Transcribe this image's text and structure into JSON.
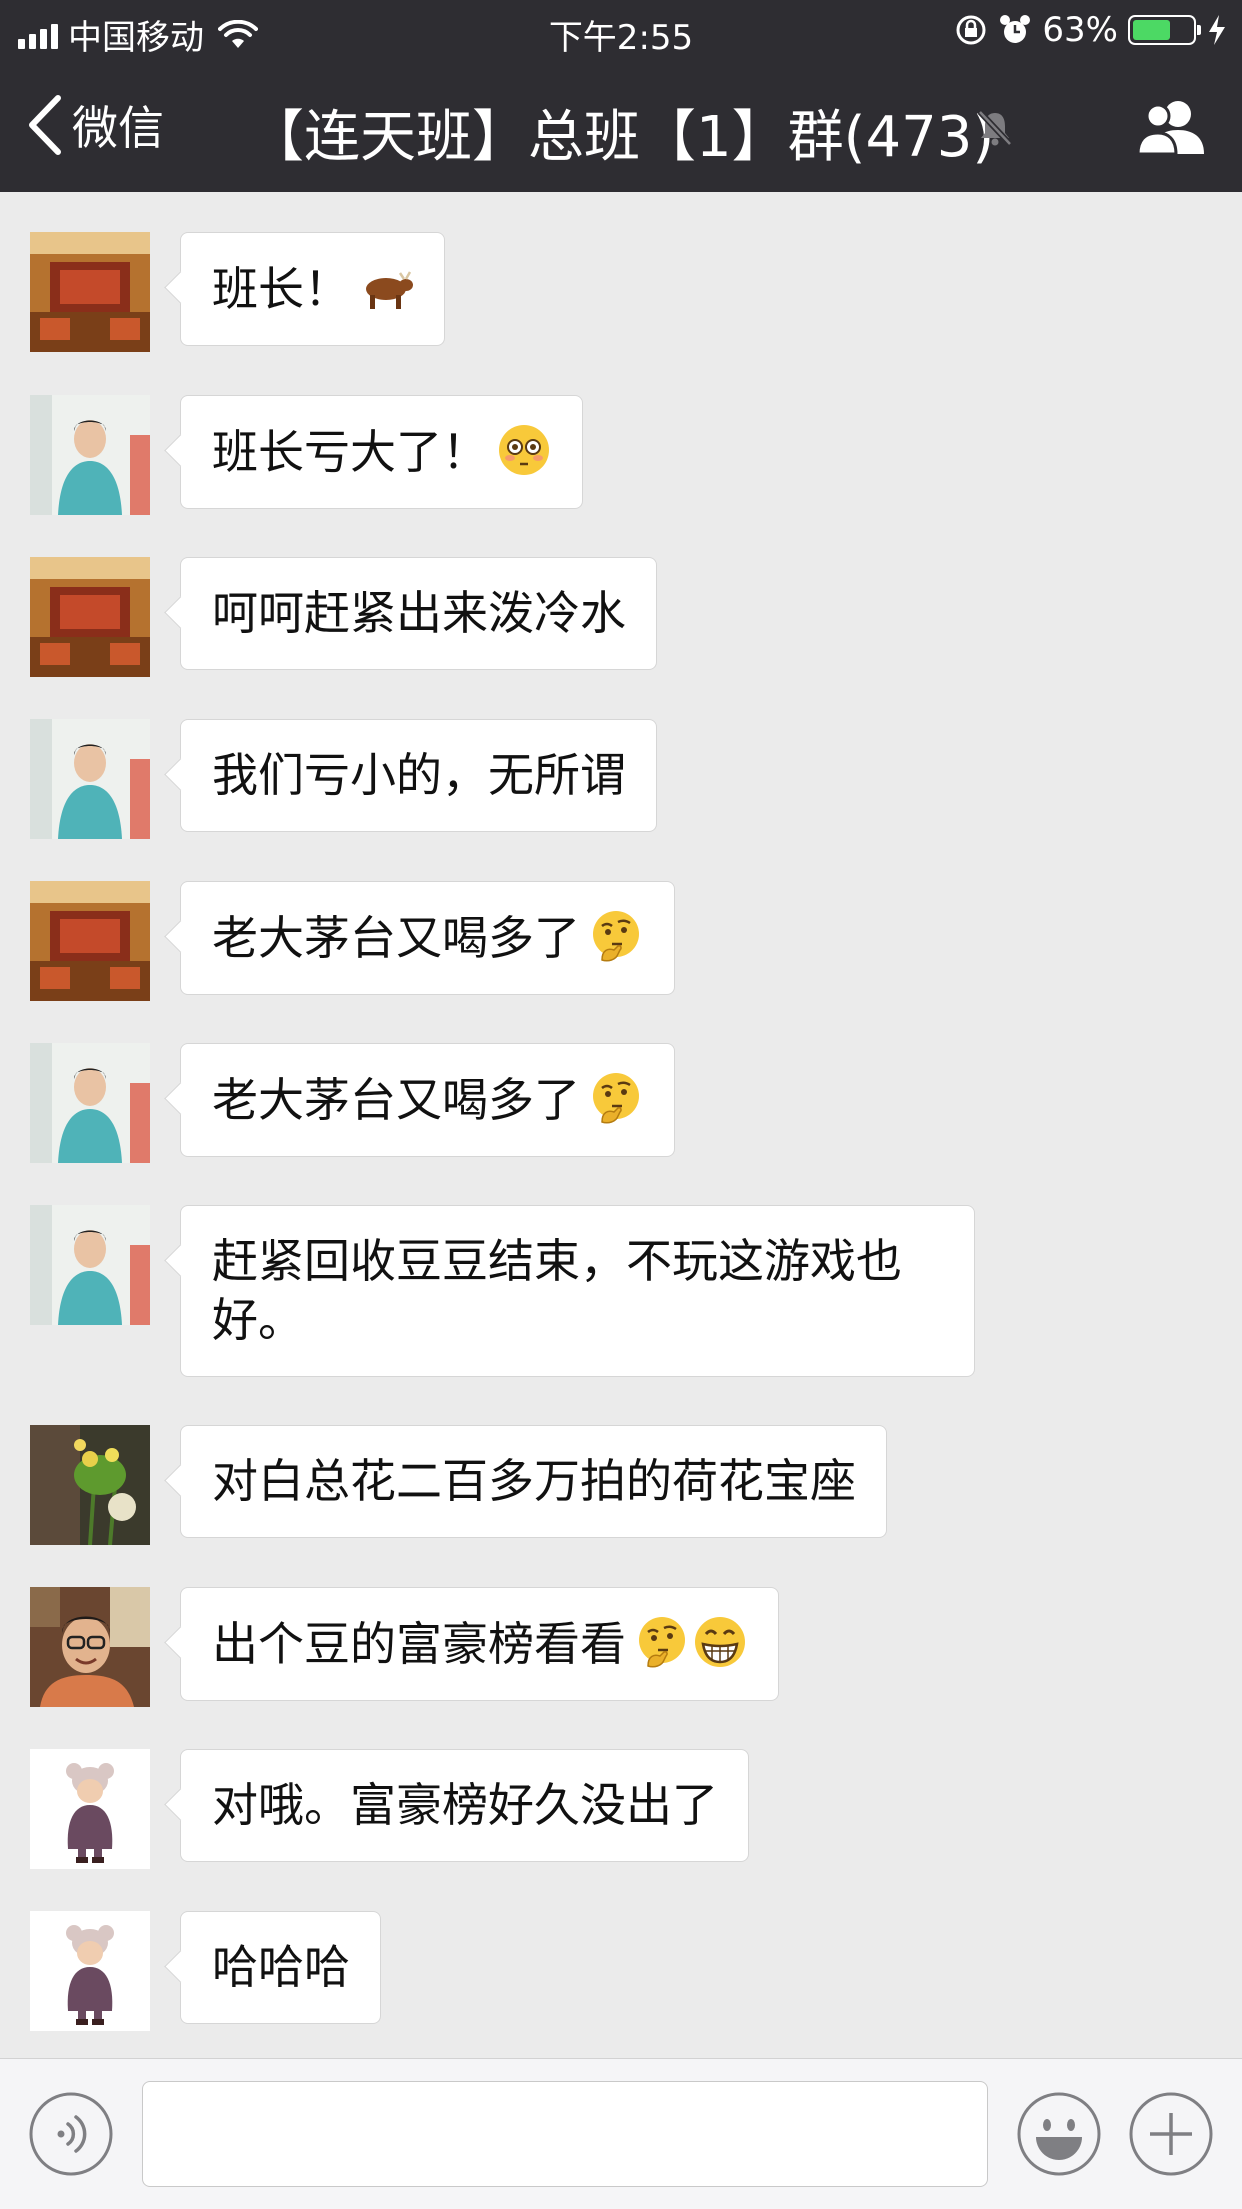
{
  "status_bar": {
    "carrier": "中国移动",
    "time": "下午2:55",
    "battery_percent": "63%",
    "battery_level": 0.63
  },
  "nav": {
    "back_label": "微信",
    "title": "【连天班】总班【1】群(473)"
  },
  "colors": {
    "nav_bg": "#2e2d32",
    "chat_bg": "#ebebeb",
    "bubble_bg": "#ffffff",
    "battery_green": "#4cd964"
  },
  "messages": [
    {
      "avatar": "room-avatar",
      "text": "班长！",
      "emoji": [
        "ox-emoji"
      ]
    },
    {
      "avatar": "woman-avatar",
      "text": "班长亏大了！",
      "emoji": [
        "flushed-face-emoji"
      ]
    },
    {
      "avatar": "room-avatar",
      "text": "呵呵赶紧出来泼冷水",
      "emoji": []
    },
    {
      "avatar": "woman-avatar",
      "text": "我们亏小的，无所谓",
      "emoji": []
    },
    {
      "avatar": "room-avatar",
      "text": "老大茅台又喝多了",
      "emoji": [
        "thinking-face-emoji"
      ]
    },
    {
      "avatar": "woman-avatar",
      "text": "老大茅台又喝多了",
      "emoji": [
        "thinking-face-emoji"
      ]
    },
    {
      "avatar": "woman-avatar",
      "text_line1": "赶紧回收豆豆结束，不玩这游戏也",
      "text_line2": "好。",
      "emoji": []
    },
    {
      "avatar": "flower-avatar",
      "text": "对白总花二百多万拍的荷花宝座",
      "emoji": []
    },
    {
      "avatar": "man-avatar",
      "text": "出个豆的富豪榜看看",
      "emoji": [
        "thinking-face-emoji",
        "grinning-face-emoji"
      ]
    },
    {
      "avatar": "child-avatar",
      "text": "对哦。富豪榜好久没出了",
      "emoji": []
    },
    {
      "avatar": "child-avatar",
      "text": "哈哈哈",
      "emoji": []
    }
  ],
  "input_bar": {
    "icons": [
      "voice-icon",
      "emoji-icon",
      "plus-icon"
    ],
    "input_value": ""
  }
}
